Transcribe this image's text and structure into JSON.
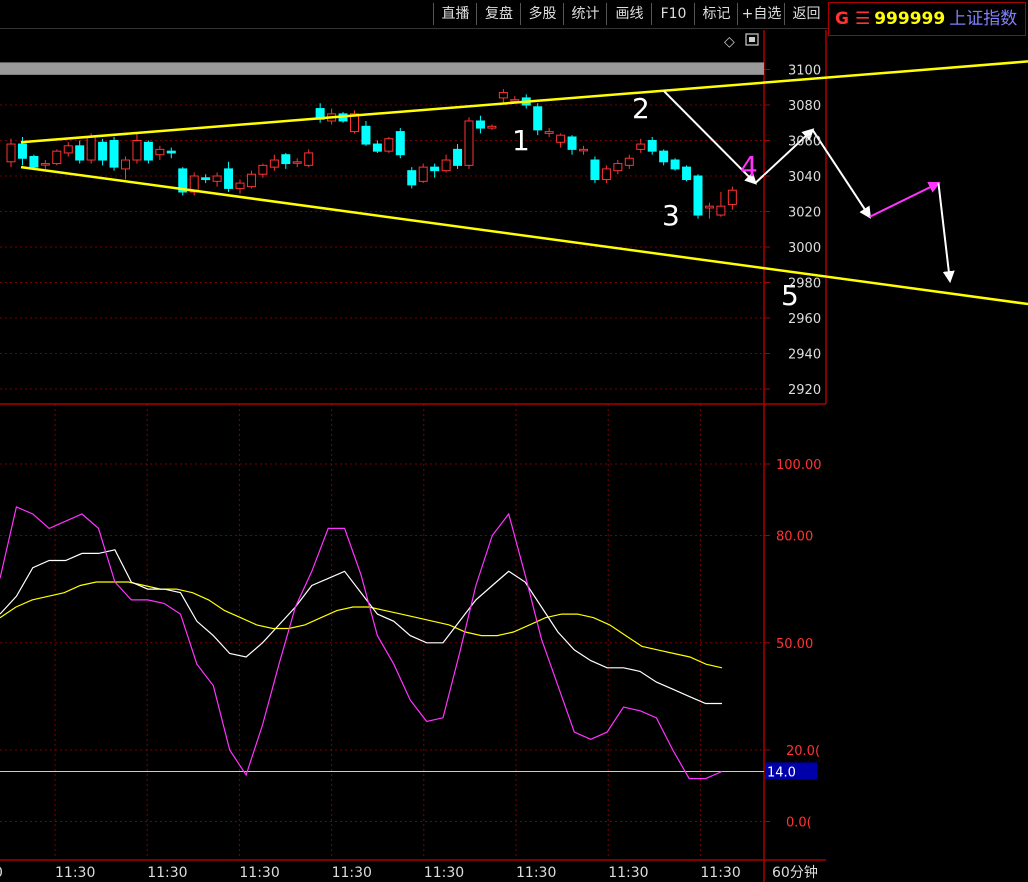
{
  "toolbar": {
    "items": [
      "直播",
      "复盘",
      "多股",
      "统计",
      "画线",
      "F10",
      "标记",
      "+自选",
      "返回"
    ]
  },
  "security": {
    "market": "G",
    "menu_icon": "menu-icon",
    "code": "999999",
    "name": "上证指数"
  },
  "window_icons": [
    "diamond-icon",
    "restore-icon"
  ],
  "timeframe": "60分钟",
  "colors": {
    "up": "#ff3333",
    "down": "#00ffff",
    "trendline": "#ffff00",
    "wave_white": "#ffffff",
    "wave_magenta": "#ff33ff",
    "kdj_k": "#ffffff",
    "kdj_d": "#ffff00",
    "kdj_j": "#ff33ff",
    "grid": "#7a0000"
  },
  "chart_data": [
    {
      "type": "candlestick",
      "title": "",
      "y_ticks": [
        "3100",
        "3080",
        "3060",
        "3040",
        "3020",
        "3000",
        "2980",
        "2960",
        "2940",
        "2920"
      ],
      "ylim": [
        2910,
        3114
      ],
      "x_tick_labels": [
        "0",
        "11:30",
        "11:30",
        "11:30",
        "11:30",
        "11:30",
        "11:30",
        "11:30",
        "11:30"
      ],
      "candles": [
        [
          3048,
          3058,
          3061,
          3045
        ],
        [
          3058,
          3050,
          3062,
          3046
        ],
        [
          3051,
          3045,
          3052,
          3044
        ],
        [
          3047,
          3047,
          3049,
          3044
        ],
        [
          3047,
          3054,
          3055,
          3046
        ],
        [
          3053,
          3057,
          3059,
          3051
        ],
        [
          3057,
          3049,
          3060,
          3047
        ],
        [
          3049,
          3062,
          3064,
          3047
        ],
        [
          3059,
          3049,
          3061,
          3046
        ],
        [
          3060,
          3045,
          3062,
          3043
        ],
        [
          3044,
          3049,
          3051,
          3038
        ],
        [
          3049,
          3060,
          3064,
          3047
        ],
        [
          3059,
          3049,
          3060,
          3047
        ],
        [
          3052,
          3055,
          3057,
          3049
        ],
        [
          3054,
          3053,
          3056,
          3050
        ],
        [
          3044,
          3031,
          3045,
          3029
        ],
        [
          3031,
          3040,
          3042,
          3029
        ],
        [
          3039,
          3038,
          3041,
          3036
        ],
        [
          3037,
          3040,
          3042,
          3034
        ],
        [
          3044,
          3033,
          3048,
          3031
        ],
        [
          3033,
          3036,
          3038,
          3030
        ],
        [
          3034,
          3041,
          3043,
          3033
        ],
        [
          3041,
          3046,
          3047,
          3039
        ],
        [
          3045,
          3049,
          3052,
          3043
        ],
        [
          3052,
          3047,
          3053,
          3044
        ],
        [
          3048,
          3048,
          3050,
          3045
        ],
        [
          3046,
          3053,
          3055,
          3045
        ],
        [
          3078,
          3072,
          3081,
          3070
        ],
        [
          3071,
          3075,
          3078,
          3069
        ],
        [
          3075,
          3071,
          3076,
          3070
        ],
        [
          3065,
          3075,
          3077,
          3064
        ],
        [
          3068,
          3058,
          3071,
          3057
        ],
        [
          3058,
          3054,
          3060,
          3053
        ],
        [
          3054,
          3061,
          3062,
          3053
        ],
        [
          3065,
          3052,
          3067,
          3050
        ],
        [
          3043,
          3035,
          3045,
          3033
        ],
        [
          3037,
          3045,
          3047,
          3036
        ],
        [
          3045,
          3043,
          3047,
          3039
        ],
        [
          3043,
          3049,
          3052,
          3042
        ],
        [
          3055,
          3046,
          3058,
          3044
        ],
        [
          3046,
          3071,
          3073,
          3044
        ],
        [
          3071,
          3067,
          3074,
          3064
        ],
        [
          3067,
          3068,
          3069,
          3066
        ],
        [
          3084,
          3087,
          3089,
          3081
        ],
        [
          3083,
          3083,
          3085,
          3082
        ],
        [
          3084,
          3080,
          3086,
          3078
        ],
        [
          3079,
          3066,
          3081,
          3063
        ],
        [
          3064,
          3065,
          3067,
          3062
        ],
        [
          3059,
          3063,
          3064,
          3056
        ],
        [
          3062,
          3055,
          3063,
          3052
        ],
        [
          3055,
          3055,
          3057,
          3052
        ],
        [
          3049,
          3038,
          3051,
          3036
        ],
        [
          3038,
          3044,
          3046,
          3036
        ],
        [
          3043,
          3047,
          3049,
          3041
        ],
        [
          3046,
          3050,
          3052,
          3044
        ],
        [
          3055,
          3058,
          3061,
          3053
        ],
        [
          3060,
          3054,
          3062,
          3052
        ],
        [
          3054,
          3048,
          3055,
          3046
        ],
        [
          3049,
          3044,
          3050,
          3043
        ],
        [
          3045,
          3038,
          3046,
          3037
        ],
        [
          3040,
          3018,
          3041,
          3016
        ],
        [
          3022,
          3023,
          3025,
          3016
        ],
        [
          3018,
          3023,
          3031,
          3017
        ],
        [
          3024,
          3032,
          3034,
          3021
        ]
      ],
      "wave_labels": [
        "1",
        "2",
        "3",
        "4",
        "5"
      ],
      "wave_points": [
        [
          3088,
          57
        ],
        [
          3036,
          65
        ],
        [
          3066,
          70
        ],
        [
          3017,
          75
        ],
        [
          3036,
          81
        ],
        [
          2981,
          82
        ]
      ],
      "trendline_upper": [
        [
          3059,
          0
        ],
        [
          3108,
          92
        ]
      ],
      "trendline_lower": [
        [
          3045,
          0
        ],
        [
          2962,
          92
        ]
      ],
      "highlight_band": [
        3097,
        3104
      ]
    },
    {
      "type": "line",
      "title": "",
      "y_ticks": [
        "100.00",
        "80.00",
        "50.00",
        "20.0(",
        "0.0("
      ],
      "ylim": [
        -6,
        111
      ],
      "current_value_label": "14.0",
      "reference_line": 14,
      "series": [
        {
          "values": [
            57,
            60,
            62,
            63,
            64,
            66,
            67,
            67,
            67,
            66,
            65,
            65,
            64,
            62,
            59,
            57,
            55,
            54,
            54,
            55,
            57,
            59,
            60,
            60,
            59,
            58,
            57,
            56,
            55,
            53,
            52,
            52,
            53,
            55,
            57,
            58,
            58,
            57,
            55,
            52,
            49,
            48,
            47,
            46,
            44,
            43
          ]
        },
        {
          "values": [
            58,
            63,
            71,
            73,
            73,
            75,
            75,
            76,
            67,
            65,
            65,
            64,
            56,
            52,
            47,
            46,
            50,
            55,
            60,
            66,
            68,
            70,
            64,
            58,
            56,
            52,
            50,
            50,
            56,
            62,
            66,
            70,
            67,
            60,
            53,
            48,
            45,
            43,
            43,
            42,
            39,
            37,
            35,
            33,
            33
          ]
        },
        {
          "values": [
            68,
            88,
            86,
            82,
            84,
            86,
            82,
            67,
            62,
            62,
            61,
            58,
            44,
            38,
            20,
            13,
            27,
            44,
            60,
            70,
            82,
            82,
            69,
            52,
            44,
            34,
            28,
            29,
            47,
            66,
            80,
            86,
            69,
            51,
            38,
            25,
            23,
            25,
            32,
            31,
            29,
            20,
            12,
            12,
            14
          ]
        }
      ]
    }
  ]
}
